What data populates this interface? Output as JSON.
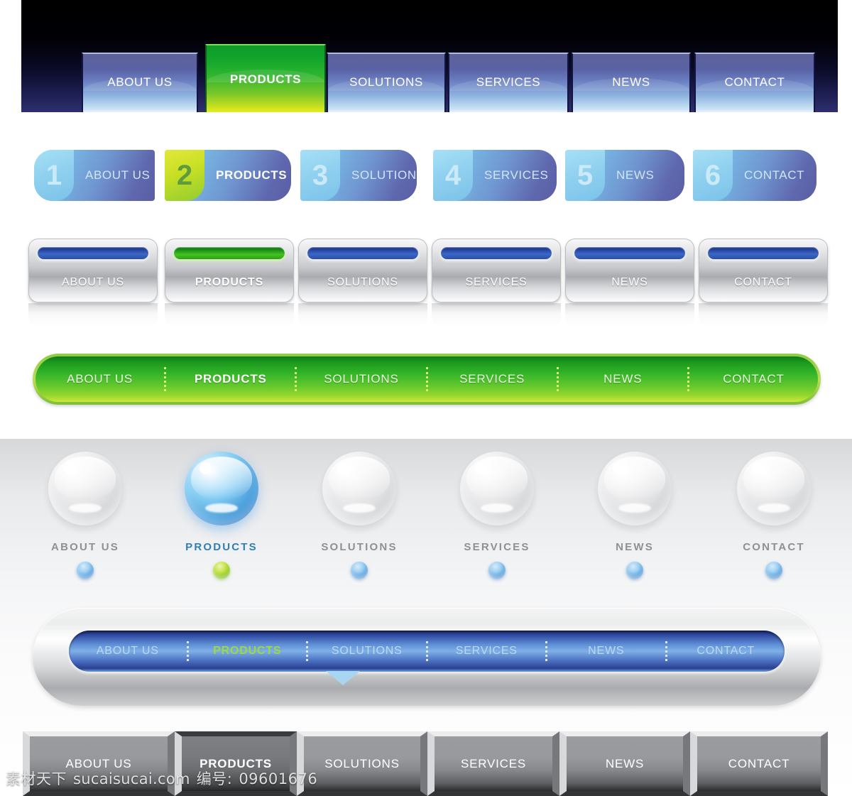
{
  "menu_items": [
    "ABOUT US",
    "PRODUCTS",
    "SOLUTIONS",
    "SERVICES",
    "NEWS",
    "CONTACT"
  ],
  "active_index": 1,
  "row1": {
    "name": "dark-header-tab-bar",
    "items": [
      "ABOUT US",
      "PRODUCTS",
      "SOLUTIONS",
      "SERVICES",
      "NEWS",
      "CONTACT"
    ]
  },
  "row2": {
    "name": "numbered-tab-bar",
    "items": [
      {
        "number": "1",
        "label": "ABOUT US"
      },
      {
        "number": "2",
        "label": "PRODUCTS"
      },
      {
        "number": "3",
        "label": "SOLUTIONS"
      },
      {
        "number": "4",
        "label": "SERVICES"
      },
      {
        "number": "5",
        "label": "NEWS"
      },
      {
        "number": "6",
        "label": "CONTACT"
      }
    ]
  },
  "row3": {
    "name": "metallic-button-bar",
    "items": [
      "ABOUT US",
      "PRODUCTS",
      "SOLUTIONS",
      "SERVICES",
      "NEWS",
      "CONTACT"
    ]
  },
  "row4": {
    "name": "green-pill-bar",
    "items": [
      "ABOUT US",
      "PRODUCTS",
      "SOLUTIONS",
      "SERVICES",
      "NEWS",
      "CONTACT"
    ]
  },
  "row5": {
    "name": "sphere-button-row",
    "items": [
      "ABOUT US",
      "PRODUCTS",
      "SOLUTIONS",
      "SERVICES",
      "NEWS",
      "CONTACT"
    ]
  },
  "row6": {
    "name": "blue-pill-bar",
    "items": [
      "ABOUT US",
      "PRODUCTS",
      "SOLUTIONS",
      "SERVICES",
      "NEWS",
      "CONTACT"
    ]
  },
  "row7": {
    "name": "bevel-grey-tab-bar",
    "items": [
      "ABOUT US",
      "PRODUCTS",
      "SOLUTIONS",
      "SERVICES",
      "NEWS",
      "CONTACT"
    ]
  },
  "watermark": {
    "brand": "素材天下",
    "site": "sucaisucai.com",
    "id_label": "编号:",
    "id_value": "09601676"
  },
  "colors": {
    "accent_green": "#35b52a",
    "accent_blue": "#2d47a0",
    "header_dark": "#000005",
    "tab_blue": "#6a7ec0",
    "active_green_text": "#9ed93f"
  }
}
